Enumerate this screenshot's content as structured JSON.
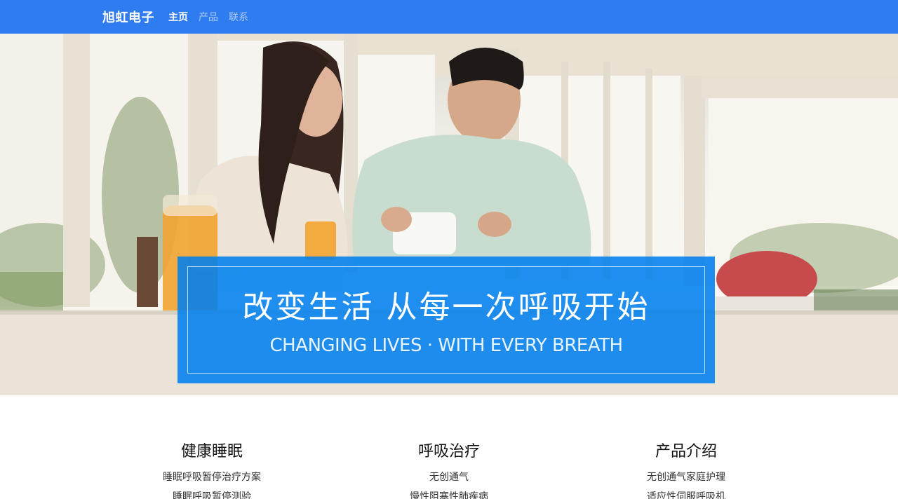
{
  "nav": {
    "brand": "旭虹电子",
    "links": [
      {
        "label": "主页",
        "active": true
      },
      {
        "label": "产品",
        "active": false
      },
      {
        "label": "联系",
        "active": false
      }
    ]
  },
  "hero": {
    "title_cn": "改变生活 从每一次呼吸开始",
    "title_en": "CHANGING LIVES · WITH EVERY BREATH"
  },
  "features": [
    {
      "title": "健康睡眠",
      "items": [
        "睡眠呼吸暂停治疗方案",
        "睡眠呼吸暂停测验"
      ]
    },
    {
      "title": "呼吸治疗",
      "items": [
        "无创通气",
        "慢性阻塞性肺疾病"
      ]
    },
    {
      "title": "产品介绍",
      "items": [
        "无创通气家庭护理",
        "适应性伺服呼吸机"
      ]
    }
  ],
  "colors": {
    "navbar": "#2f7bf0",
    "banner": "#0080ee",
    "text": "#222222"
  }
}
